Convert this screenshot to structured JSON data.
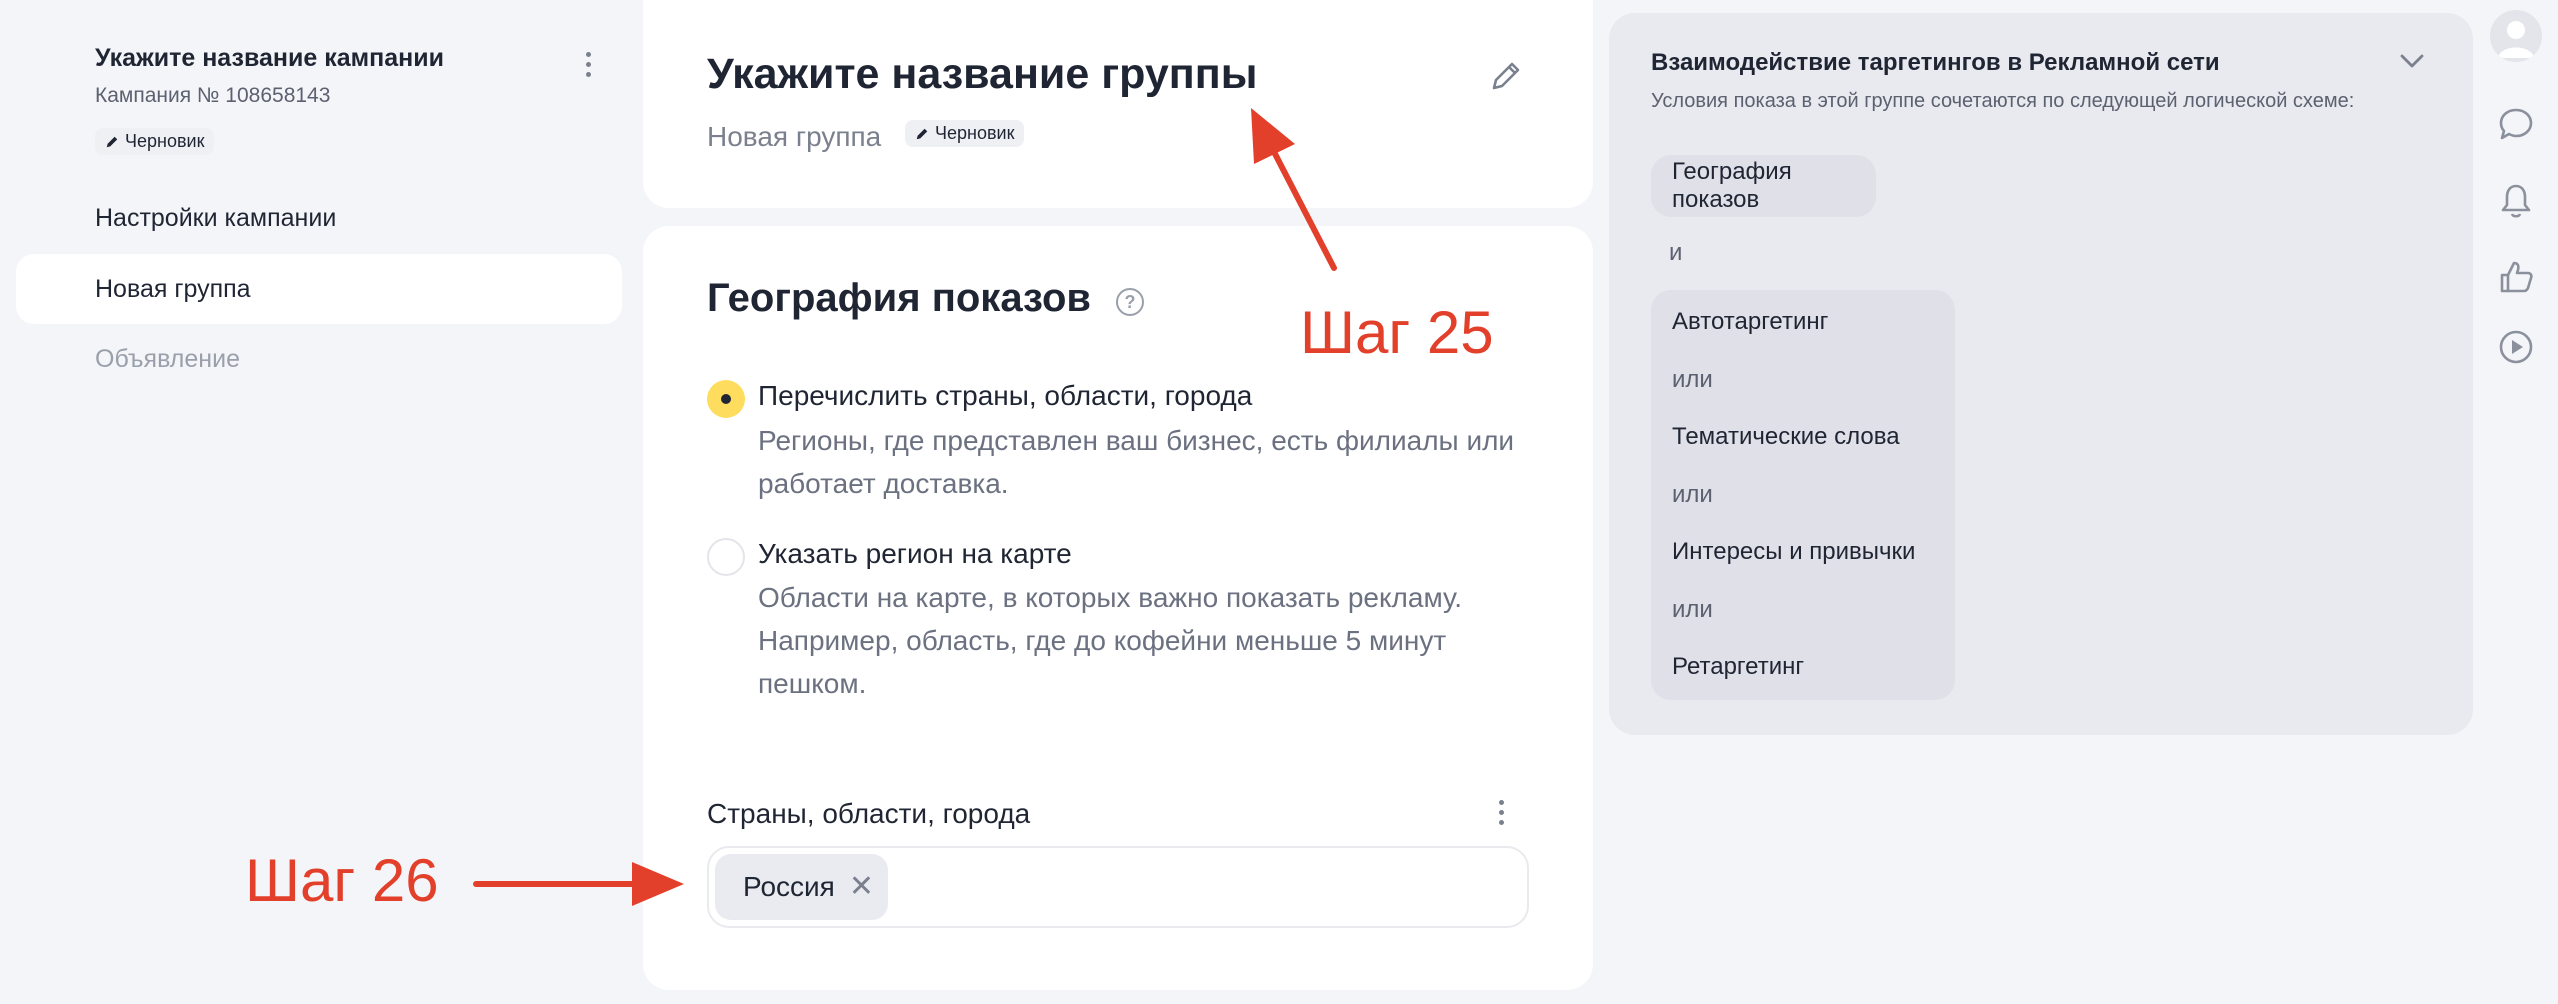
{
  "sidebar": {
    "campaign_title": "Укажите название кампании",
    "campaign_number": "Кампания № 108658143",
    "draft_label": "Черновик",
    "items": [
      {
        "label": "Настройки кампании"
      },
      {
        "label": "Новая группа"
      },
      {
        "label": "Объявление"
      }
    ]
  },
  "group_card": {
    "title": "Укажите название группы",
    "subtitle": "Новая группа",
    "draft_label": "Черновик"
  },
  "geo": {
    "title": "География показов",
    "help_glyph": "?",
    "options": [
      {
        "label": "Перечислить страны, области, города",
        "description": "Регионы, где представлен ваш бизнес, есть филиалы или работает доставка.",
        "selected": true
      },
      {
        "label": "Указать регион на карте",
        "description": "Области на карте, в которых важно показать рекламу. Например, область, где до кофейни меньше 5 минут пешком.",
        "selected": false
      }
    ],
    "field_label": "Страны, области, города",
    "tags": [
      {
        "label": "Россия",
        "remove_glyph": "✕"
      }
    ]
  },
  "targeting_panel": {
    "title": "Взаимодействие таргетингов в Рекламной сети",
    "subtitle": "Условия показа в этой группе сочетаются по следующей логической схеме:",
    "first_chip": "География показов",
    "and_label": "и",
    "group_items": [
      "Автотаргетинг",
      "или",
      "Тематические слова",
      "или",
      "Интересы и привычки",
      "или",
      "Ретаргетинг"
    ]
  },
  "rail": {
    "icons": [
      "avatar-icon",
      "chat-icon",
      "bell-icon",
      "thumbs-up-icon",
      "play-icon"
    ]
  },
  "annotations": {
    "step25": "Шаг 25",
    "step26": "Шаг 26",
    "color": "#e2402b"
  },
  "colors": {
    "background": "#f4f5f8",
    "card": "#ffffff",
    "radio_selected": "#fedd5e",
    "panel": "#e9eaef"
  }
}
